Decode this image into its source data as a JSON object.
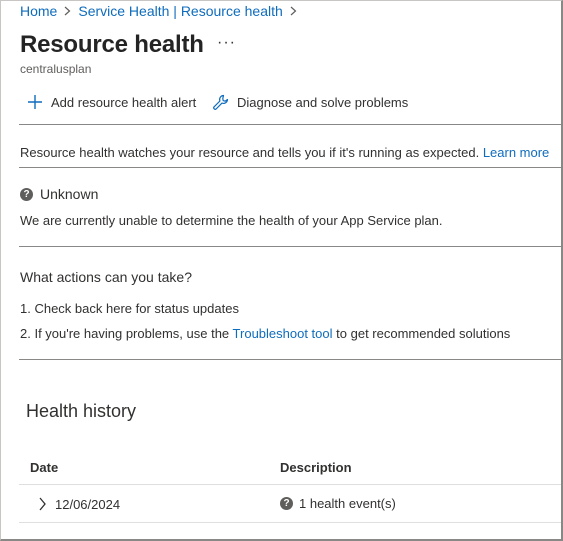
{
  "breadcrumb": {
    "home": "Home",
    "service_health": "Service Health | Resource health"
  },
  "header": {
    "title": "Resource health",
    "more_label": "···",
    "subtitle": "centralusplan"
  },
  "toolbar": {
    "add_alert_label": "Add resource health alert",
    "diagnose_label": "Diagnose and solve problems"
  },
  "info": {
    "text": "Resource health watches your resource and tells you if it's running as expected.",
    "learn_more": "Learn more"
  },
  "status": {
    "label": "Unknown",
    "description": "We are currently unable to determine the health of your App Service plan."
  },
  "actions": {
    "title": "What actions can you take?",
    "item1": "1.  Check back here for status updates",
    "item2_prefix": "2.  If you're having problems, use the",
    "item2_link": "Troubleshoot tool",
    "item2_suffix": "to get recommended solutions"
  },
  "history": {
    "title": "Health history",
    "columns": {
      "date": "Date",
      "description": "Description"
    },
    "rows": [
      {
        "date": "12/06/2024",
        "description": "1 health event(s)"
      }
    ]
  },
  "colors": {
    "link": "#0f6cbd",
    "icon_gray": "#605e5c"
  }
}
